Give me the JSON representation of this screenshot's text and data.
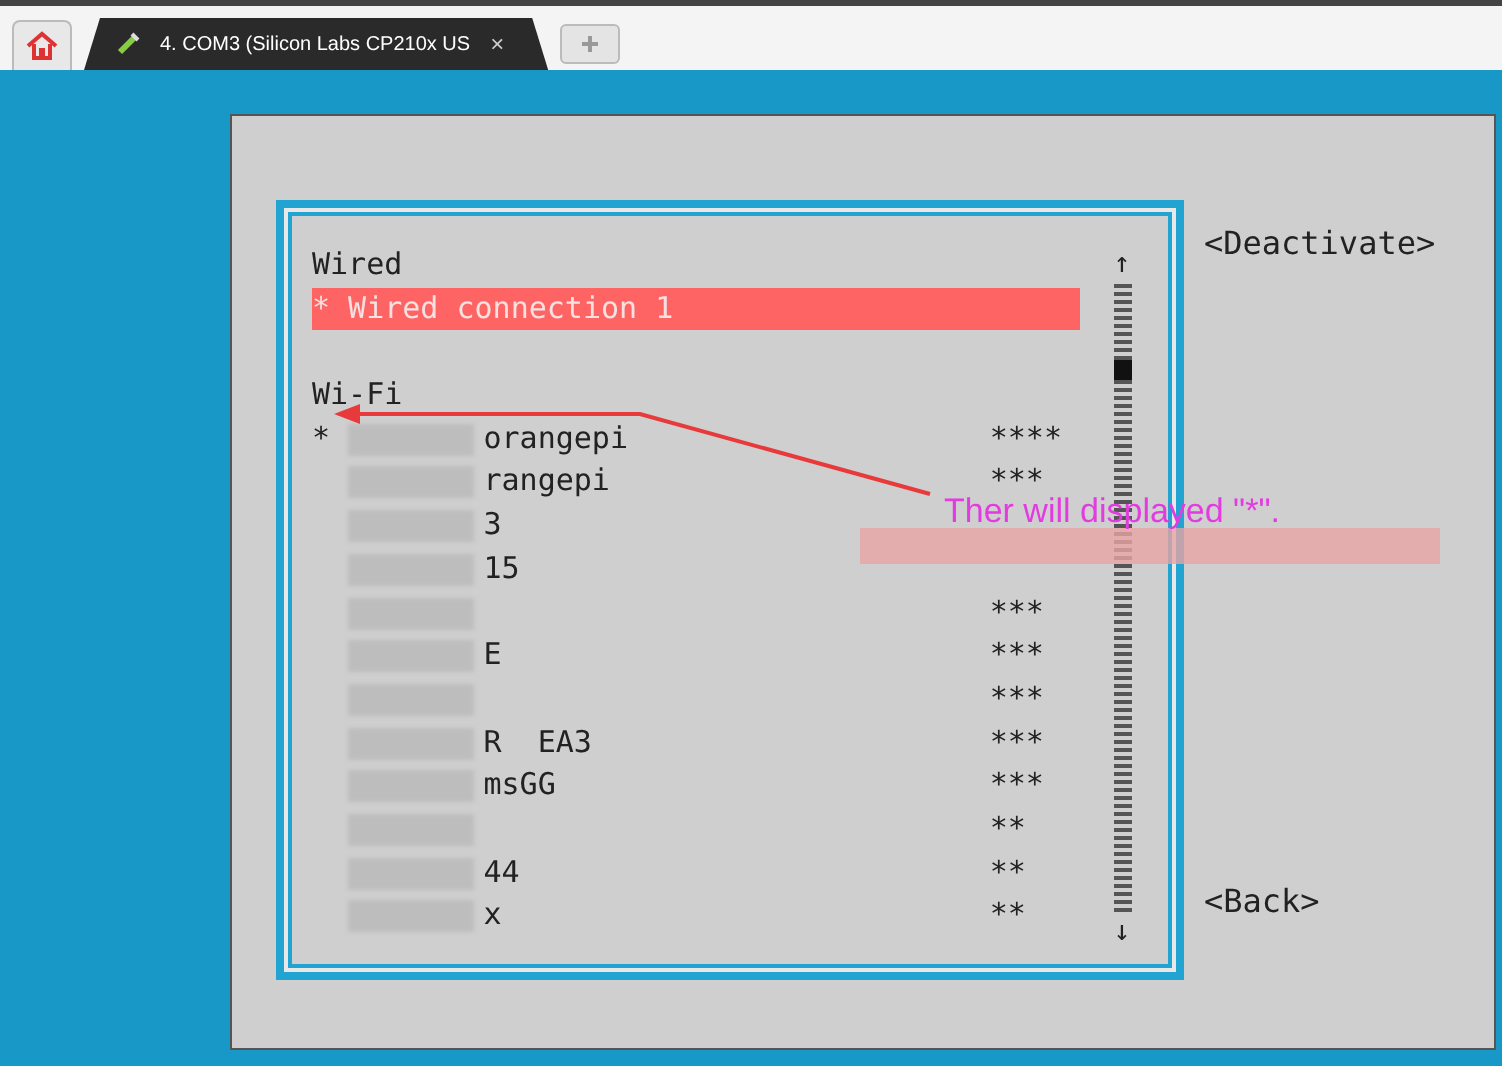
{
  "tabs": [
    {
      "label": "4. COM3 (Silicon Labs CP210x US",
      "close": "×",
      "selected": true
    }
  ],
  "sections": [
    {
      "title": "Wired",
      "items": [
        {
          "marker": "*",
          "name": "Wired connection 1",
          "selected": true
        }
      ]
    },
    {
      "title": "Wi-Fi",
      "items": [
        {
          "marker": "*",
          "name": "orangepi",
          "signal": "****",
          "selected": false
        },
        {
          "name": "rangepi",
          "signal": "***",
          "selected": false
        },
        {
          "name": "3",
          "selected": false
        },
        {
          "name": "15",
          "selected": false
        },
        {
          "signal": "***",
          "selected": false
        },
        {
          "name": "E",
          "signal": "***",
          "selected": false
        },
        {
          "signal": "***",
          "selected": false
        },
        {
          "name": "R  EA3",
          "signal": "***",
          "selected": false
        },
        {
          "name": "msGG",
          "signal": "***",
          "selected": false
        },
        {
          "signal": "**",
          "selected": false
        },
        {
          "name": "44",
          "signal": "**",
          "selected": false
        },
        {
          "name": "x",
          "signal": "**",
          "selected": false
        }
      ]
    }
  ],
  "scrollbar": {
    "up": "↑",
    "down": "↓"
  },
  "buttons": [
    "<Deactivate>",
    "<Back>"
  ],
  "annotation": {
    "text": "Ther will displayed \"*\"."
  }
}
